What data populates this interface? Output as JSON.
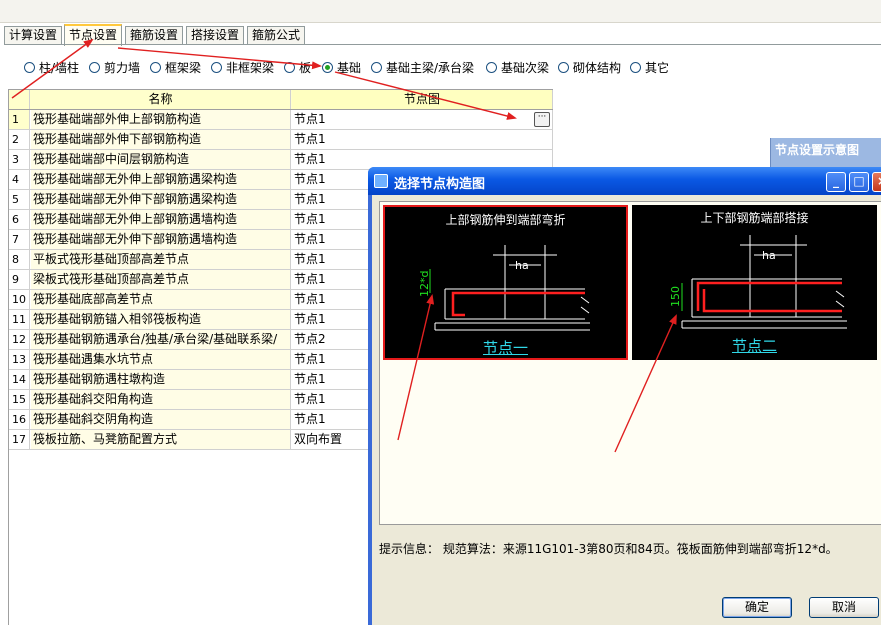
{
  "tabs": [
    "计算设置",
    "节点设置",
    "箍筋设置",
    "搭接设置",
    "箍筋公式"
  ],
  "active_tab": 1,
  "radio_options": [
    "柱/墙柱",
    "剪力墙",
    "框架梁",
    "非框架梁",
    "板",
    "基础",
    "基础主梁/承台梁",
    "基础次梁",
    "砌体结构",
    "其它"
  ],
  "selected_radio": 5,
  "table": {
    "headers": [
      "名称",
      "节点图"
    ],
    "rows": [
      {
        "idx": "1",
        "name": "筏形基础端部外伸上部钢筋构造",
        "node": "节点1"
      },
      {
        "idx": "2",
        "name": "筏形基础端部外伸下部钢筋构造",
        "node": "节点1"
      },
      {
        "idx": "3",
        "name": "筏形基础端部中间层钢筋构造",
        "node": "节点1"
      },
      {
        "idx": "4",
        "name": "筏形基础端部无外伸上部钢筋遇梁构造",
        "node": "节点1"
      },
      {
        "idx": "5",
        "name": "筏形基础端部无外伸下部钢筋遇梁构造",
        "node": "节点1"
      },
      {
        "idx": "6",
        "name": "筏形基础端部无外伸上部钢筋遇墙构造",
        "node": "节点1"
      },
      {
        "idx": "7",
        "name": "筏形基础端部无外伸下部钢筋遇墙构造",
        "node": "节点1"
      },
      {
        "idx": "8",
        "name": "平板式筏形基础顶部高差节点",
        "node": "节点1"
      },
      {
        "idx": "9",
        "name": "梁板式筏形基础顶部高差节点",
        "node": "节点1"
      },
      {
        "idx": "10",
        "name": "筏形基础底部高差节点",
        "node": "节点1"
      },
      {
        "idx": "11",
        "name": "筏形基础钢筋锚入相邻筏板构造",
        "node": "节点1"
      },
      {
        "idx": "12",
        "name": "筏形基础钢筋遇承台/独基/承台梁/基础联系梁/",
        "node": "节点2"
      },
      {
        "idx": "13",
        "name": "筏形基础遇集水坑节点",
        "node": "节点1"
      },
      {
        "idx": "14",
        "name": "筏形基础钢筋遇柱墩构造",
        "node": "节点1"
      },
      {
        "idx": "15",
        "name": "筏形基础斜交阳角构造",
        "node": "节点1"
      },
      {
        "idx": "16",
        "name": "筏形基础斜交阴角构造",
        "node": "节点1"
      },
      {
        "idx": "17",
        "name": "筏板拉筋、马凳筋配置方式",
        "node": "双向布置"
      }
    ]
  },
  "ellipsis_label": "···",
  "background_panel_title": "节点设置示意图",
  "dialog": {
    "title": "选择节点构造图",
    "thumbnails": [
      {
        "title": "上部钢筋伸到端部弯折",
        "caption": "节点一",
        "dim_label": "12*d",
        "ha_label": "ha",
        "selected": true
      },
      {
        "title": "上下部钢筋端部搭接",
        "caption": "节点二",
        "dim_label": "150",
        "ha_label": "ha",
        "selected": false
      }
    ],
    "hint": "提示信息： 规范算法：来源11G101-3第80页和84页。筏板面筋伸到端部弯折12*d。",
    "ok_label": "确定",
    "cancel_label": "取消",
    "min_symbol": "_",
    "max_symbol": "□",
    "close_symbol": "×"
  },
  "colors": {
    "annotation_red": "#e02020",
    "title_blue": "#0a58e4",
    "header_yellow": "#ffffcc",
    "name_column": "#fffde6",
    "caption_cyan": "#30d8e8",
    "dim_green": "#20e020"
  }
}
